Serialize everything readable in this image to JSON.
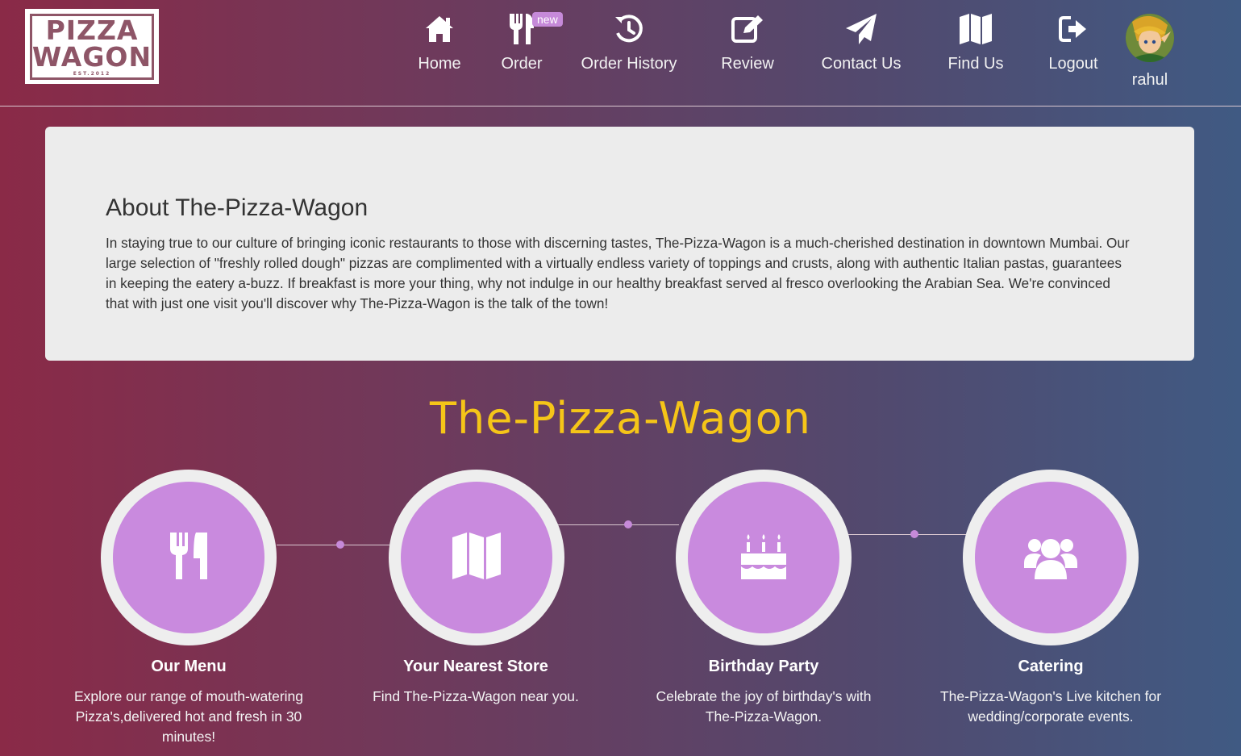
{
  "logo": {
    "line1": "PIZZA",
    "line2": "WAGON",
    "est": "EST.2012"
  },
  "nav": {
    "items": [
      {
        "label": "Home",
        "icon": "home-icon"
      },
      {
        "label": "Order",
        "icon": "cutlery-icon",
        "badge": "new"
      },
      {
        "label": "Order History",
        "icon": "history-icon"
      },
      {
        "label": "Review",
        "icon": "edit-icon"
      },
      {
        "label": "Contact Us",
        "icon": "paper-plane-icon"
      },
      {
        "label": "Find Us",
        "icon": "map-icon"
      },
      {
        "label": "Logout",
        "icon": "logout-icon"
      }
    ],
    "user": {
      "name": "rahul"
    }
  },
  "about": {
    "title": "About The-Pizza-Wagon",
    "body": "In staying true to our culture of bringing iconic restaurants to those with discerning tastes, The-Pizza-Wagon is a much-cherished destination in downtown Mumbai. Our large selection of \"freshly rolled dough\" pizzas are complimented with a virtually endless variety of toppings and crusts, along with authentic Italian pastas, guarantees in keeping the eatery a-buzz. If breakfast is more your thing, why not indulge in our healthy breakfast served al fresco overlooking the Arabian Sea. We're convinced that with just one visit you'll discover why The-Pizza-Wagon is the talk of the town!"
  },
  "brand_title": "The-Pizza-Wagon",
  "features": [
    {
      "title": "Our Menu",
      "desc": "Explore our range of mouth-watering Pizza's,delivered hot and fresh in 30 minutes!",
      "icon": "cutlery-icon"
    },
    {
      "title": "Your Nearest Store",
      "desc": "Find The-Pizza-Wagon near you.",
      "icon": "map-icon"
    },
    {
      "title": "Birthday Party",
      "desc": "Celebrate the joy of birthday's with The-Pizza-Wagon.",
      "icon": "birthday-cake-icon"
    },
    {
      "title": "Catering",
      "desc": "The-Pizza-Wagon's Live kitchen for wedding/corporate events.",
      "icon": "users-icon"
    }
  ],
  "colors": {
    "accent": "#c98ade",
    "brand_yellow": "#f5c518",
    "panel": "#ececec"
  }
}
